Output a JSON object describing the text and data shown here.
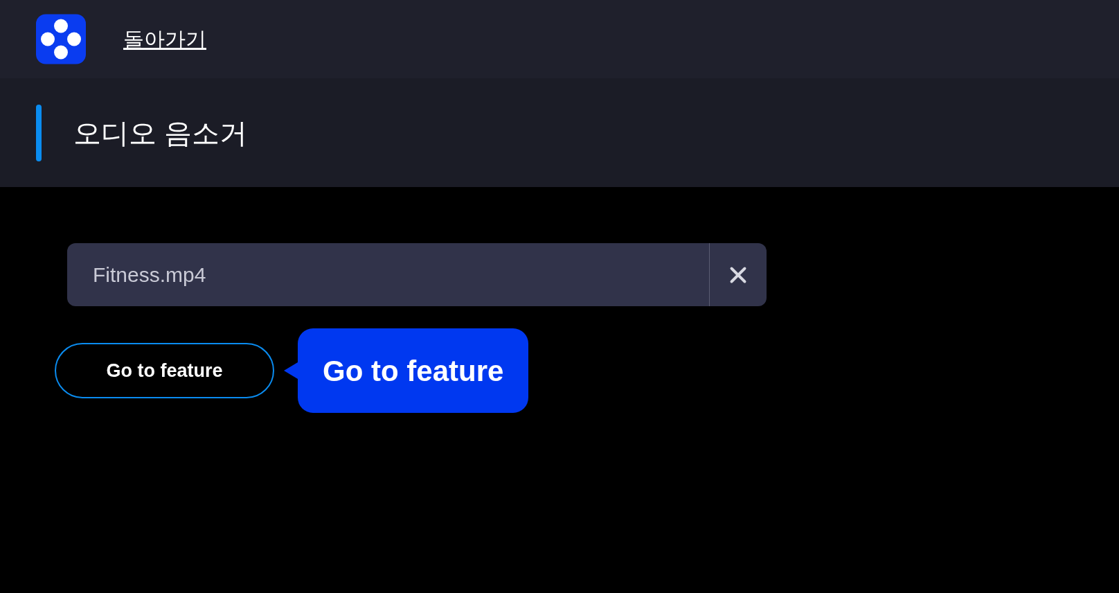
{
  "header": {
    "back_link": "돌아가기"
  },
  "title_bar": {
    "title": "오디오 음소거"
  },
  "file_field": {
    "value": "Fitness.mp4"
  },
  "feature_button": {
    "label": "Go to feature"
  },
  "tooltip": {
    "text": "Go to feature"
  }
}
